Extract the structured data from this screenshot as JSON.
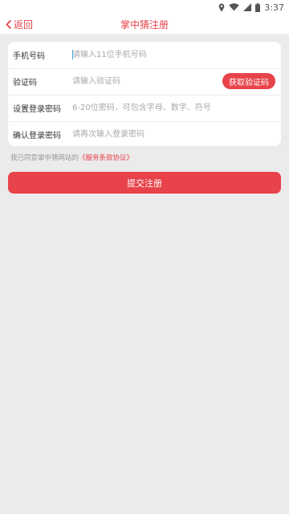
{
  "status_bar": {
    "time": "3:37",
    "icons": [
      "location-icon",
      "wifi-icon",
      "signal-icon",
      "battery-icon"
    ]
  },
  "nav": {
    "back_label": "返回",
    "title": "掌中猜注册"
  },
  "form": {
    "phone": {
      "label": "手机号码",
      "placeholder": "请输入11位手机号码",
      "value": ""
    },
    "code": {
      "label": "验证码",
      "placeholder": "请输入验证码",
      "value": "",
      "button_label": "获取验证码"
    },
    "password": {
      "label": "设置登录密码",
      "placeholder": "6-20位密码，可包含字母、数字、符号",
      "value": ""
    },
    "confirm": {
      "label": "确认登录密码",
      "placeholder": "请再次输入登录密码",
      "value": ""
    }
  },
  "agreement": {
    "text": "我已同意掌中猜网站的",
    "link": "《服务条款协议》"
  },
  "submit_label": "提交注册",
  "colors": {
    "accent": "#e8424a",
    "background": "#ebebeb",
    "card": "#ffffff"
  }
}
